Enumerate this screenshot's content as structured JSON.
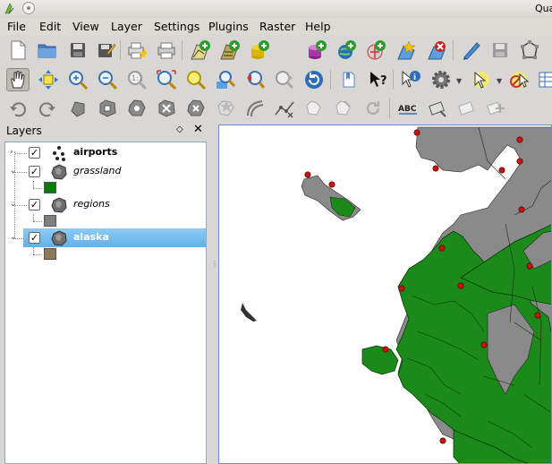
{
  "window": {
    "title": "Qua"
  },
  "menu": [
    "File",
    "Edit",
    "View",
    "Layer",
    "Settings",
    "Plugins",
    "Raster",
    "Help"
  ],
  "toolbar1": [
    "new-project-icon",
    "open-project-icon",
    "save-project-icon",
    "save-as-icon",
    "new-print-composer-icon",
    "print-icon",
    "add-vector-layer-icon",
    "add-raster-layer-icon",
    "add-postgis-layer-icon",
    "add-spatialite-layer-icon",
    "add-wms-layer-icon",
    "add-wfs-layer-icon",
    "new-shapefile-icon",
    "remove-layer-icon",
    "toggle-editing-icon",
    "save-edits-icon",
    "digitize-icon"
  ],
  "toolbar2": [
    "pan-icon",
    "pan-to-selection-icon",
    "zoom-in-icon",
    "zoom-out-icon",
    "zoom-native-icon",
    "zoom-full-icon",
    "zoom-to-selection-icon",
    "zoom-to-layer-icon",
    "zoom-last-icon",
    "zoom-next-icon",
    "refresh-icon",
    "bookmark-icon",
    "whats-this-icon",
    "identify-icon",
    "settings-icon",
    "select-icon",
    "deselect-icon",
    "attribute-table-icon"
  ],
  "toolbar3": [
    "undo-icon",
    "redo-icon",
    "simplify-icon",
    "add-ring-icon",
    "add-part-icon",
    "delete-ring-icon",
    "delete-part-icon",
    "reshape-icon",
    "offset-curve-icon",
    "split-icon",
    "merge-icon",
    "merge-attributes-icon",
    "rotate-icon",
    "label-icon",
    "pin-labels-icon",
    "show-hide-labels-icon",
    "move-label-icon"
  ],
  "layers_panel": {
    "title": "Layers",
    "layers": [
      {
        "name": "airports",
        "style": "bold",
        "checked": true
      },
      {
        "name": "grassland",
        "style": "italic",
        "checked": true,
        "swatch": "#0a7a0a"
      },
      {
        "name": "regions",
        "style": "italic",
        "checked": true,
        "swatch": "#808080"
      },
      {
        "name": "alaska",
        "style": "bold",
        "checked": true,
        "swatch": "#8c7b5a",
        "selected": true
      }
    ]
  },
  "colors": {
    "grassland": "#1b8a1b",
    "regions": "#8a8a8a",
    "airports": "#cc1111",
    "selection": "#6ab6ee"
  }
}
